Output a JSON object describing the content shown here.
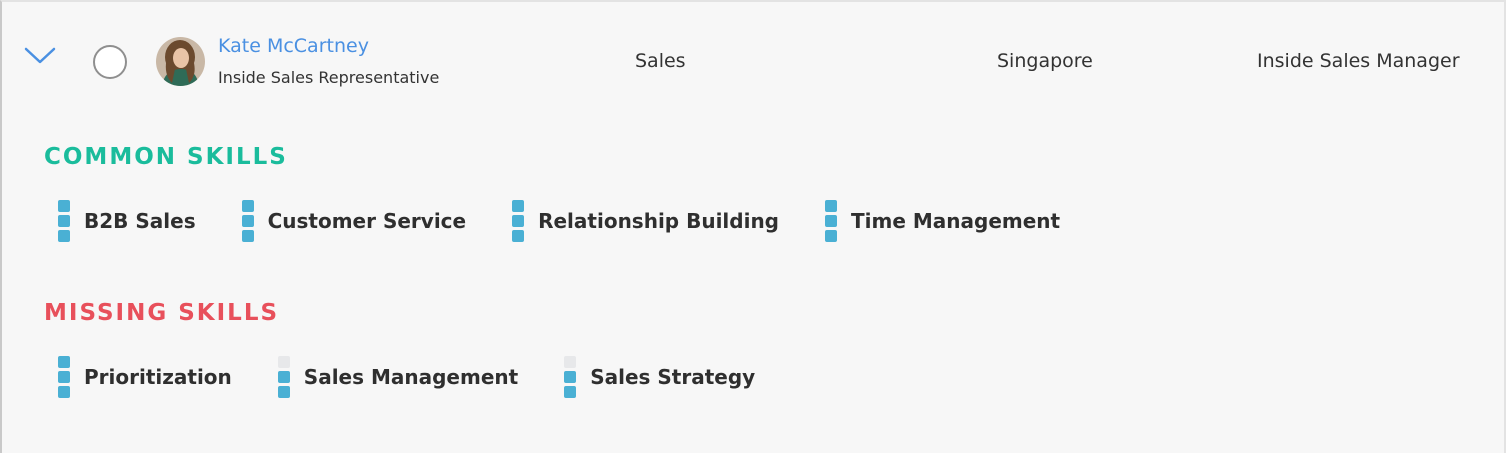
{
  "employee": {
    "name": "Kate McCartney",
    "title": "Inside Sales Representative",
    "department": "Sales",
    "location": "Singapore",
    "target_role": "Inside Sales Manager"
  },
  "common_skills": {
    "heading": "COMMON SKILLS",
    "items": [
      {
        "label": "B2B Sales",
        "level": 3,
        "max": 3
      },
      {
        "label": "Customer Service",
        "level": 3,
        "max": 3
      },
      {
        "label": "Relationship Building",
        "level": 3,
        "max": 3
      },
      {
        "label": "Time Management",
        "level": 3,
        "max": 3
      }
    ]
  },
  "missing_skills": {
    "heading": "MISSING SKILLS",
    "items": [
      {
        "label": "Prioritization",
        "level": 3,
        "max": 3
      },
      {
        "label": "Sales Management",
        "level": 2,
        "max": 3
      },
      {
        "label": "Sales Strategy",
        "level": 2,
        "max": 3
      }
    ]
  },
  "colors": {
    "link": "#4a90e2",
    "common_heading": "#1abc9c",
    "missing_heading": "#e8505b",
    "skill_bar": "#4ab0d4",
    "skill_bar_empty": "#e7e8ea"
  },
  "icons": {
    "expand": "chevron-down-icon",
    "select": "radio-circle",
    "avatar": "profile-photo"
  }
}
